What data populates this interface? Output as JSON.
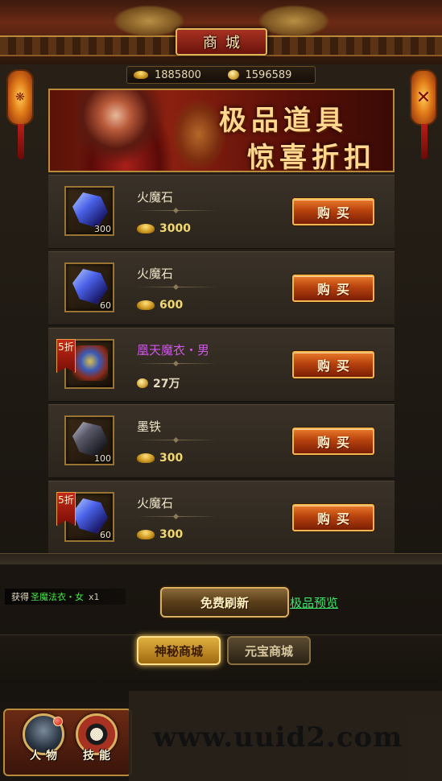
{
  "header": {
    "title": "商城",
    "close_icon": "close-icon"
  },
  "currency": {
    "gold_ingot": "1885800",
    "coins": "1596589"
  },
  "banner": {
    "line1": "极品道具",
    "line2": "惊喜折扣"
  },
  "items": [
    {
      "name": "火魔石",
      "qty": "300",
      "price": "3000",
      "currency": "ingot",
      "discount": "",
      "buy_label": "购买",
      "icon": "blue-gem-icon"
    },
    {
      "name": "火魔石",
      "qty": "60",
      "price": "600",
      "currency": "ingot",
      "discount": "",
      "buy_label": "购买",
      "icon": "blue-gem-icon"
    },
    {
      "name": "凰天魔衣・男",
      "qty": "",
      "price": "27万",
      "currency": "coin",
      "discount": "5折",
      "buy_label": "购买",
      "icon": "armor-icon"
    },
    {
      "name": "墨铁",
      "qty": "100",
      "price": "300",
      "currency": "ingot",
      "discount": "",
      "buy_label": "购买",
      "icon": "dark-ore-icon"
    },
    {
      "name": "火魔石",
      "qty": "60",
      "price": "300",
      "currency": "ingot",
      "discount": "5折",
      "buy_label": "购买",
      "icon": "blue-gem-icon"
    }
  ],
  "notice": {
    "prefix": "获得",
    "item": "圣魔法衣・女",
    "count": "x1"
  },
  "actions": {
    "refresh_label": "免费刷新",
    "preview_label": "极品预览"
  },
  "tabs": {
    "mystery": "神秘商城",
    "yuanbao": "元宝商城"
  },
  "bottom_nav": {
    "character": "人物",
    "skill": "技能"
  },
  "watermark": "www.uuid2.com"
}
